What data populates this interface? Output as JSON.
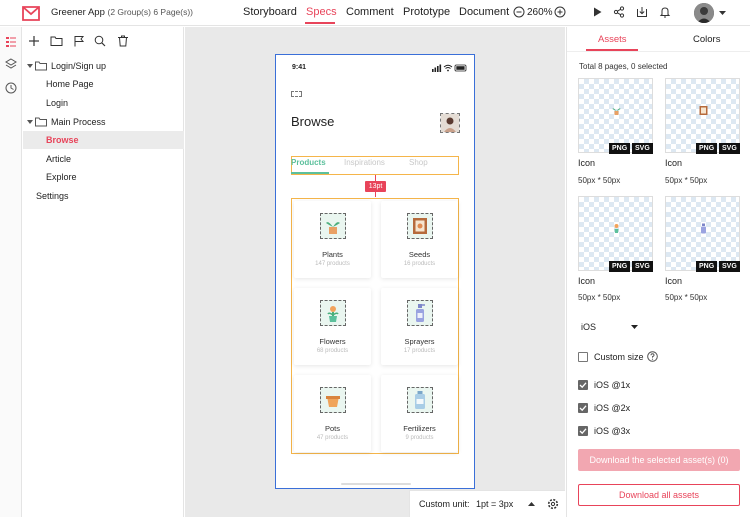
{
  "app": {
    "name": "Greener App",
    "meta": "(2 Group(s) 6 Page(s))"
  },
  "nav": {
    "tabs": [
      "Storyboard",
      "Specs",
      "Comment",
      "Prototype",
      "Document"
    ],
    "active": "Specs",
    "zoom": "260%"
  },
  "layers": {
    "items": [
      {
        "label": "Login/Sign up",
        "type": "group"
      },
      {
        "label": "Home Page",
        "type": "page"
      },
      {
        "label": "Login",
        "type": "page"
      },
      {
        "label": "Main Process",
        "type": "group"
      },
      {
        "label": "Browse",
        "type": "page",
        "selected": true
      },
      {
        "label": "Article",
        "type": "page"
      },
      {
        "label": "Explore",
        "type": "page"
      },
      {
        "label": "Settings",
        "type": "page"
      }
    ]
  },
  "phone": {
    "time": "9:41",
    "title": "Browse",
    "tabs": [
      "Products",
      "Inspirations",
      "Shop"
    ],
    "spacing_label": "13pt",
    "categories": [
      {
        "name": "Plants",
        "count": "147 products",
        "icon": "potted-plant-icon"
      },
      {
        "name": "Seeds",
        "count": "16 products",
        "icon": "seeds-frame-icon"
      },
      {
        "name": "Flowers",
        "count": "68 products",
        "icon": "flower-pot-icon"
      },
      {
        "name": "Sprayers",
        "count": "17 products",
        "icon": "sprayer-icon"
      },
      {
        "name": "Pots",
        "count": "47 products",
        "icon": "pot-icon"
      },
      {
        "name": "Fertilizers",
        "count": "9 products",
        "icon": "fertilizer-icon"
      }
    ]
  },
  "bottombar": {
    "unit_label": "Custom unit:",
    "unit_value": "1pt = 3px"
  },
  "right": {
    "tabs": [
      "Assets",
      "Colors"
    ],
    "active": "Assets",
    "summary": "Total 8 pages, 0 selected",
    "assets": [
      {
        "name": "Icon",
        "size": "50px * 50px",
        "formats": [
          "PNG",
          "SVG"
        ]
      },
      {
        "name": "Icon",
        "size": "50px * 50px",
        "formats": [
          "PNG",
          "SVG"
        ]
      },
      {
        "name": "Icon",
        "size": "50px * 50px",
        "formats": [
          "PNG",
          "SVG"
        ]
      },
      {
        "name": "Icon",
        "size": "50px * 50px",
        "formats": [
          "PNG",
          "SVG"
        ]
      }
    ],
    "platform": "iOS",
    "custom_size": "Custom size",
    "scales": [
      {
        "label": "iOS @1x",
        "checked": true
      },
      {
        "label": "iOS @2x",
        "checked": true
      },
      {
        "label": "iOS @3x",
        "checked": true
      }
    ],
    "download_selected": "Download the selected asset(s) (0)",
    "download_all": "Download all assets"
  },
  "colors": {
    "accent": "#e8445a",
    "frame": "#3a6fd8",
    "guide": "#f5b54a",
    "product_green": "#5cc09c"
  }
}
